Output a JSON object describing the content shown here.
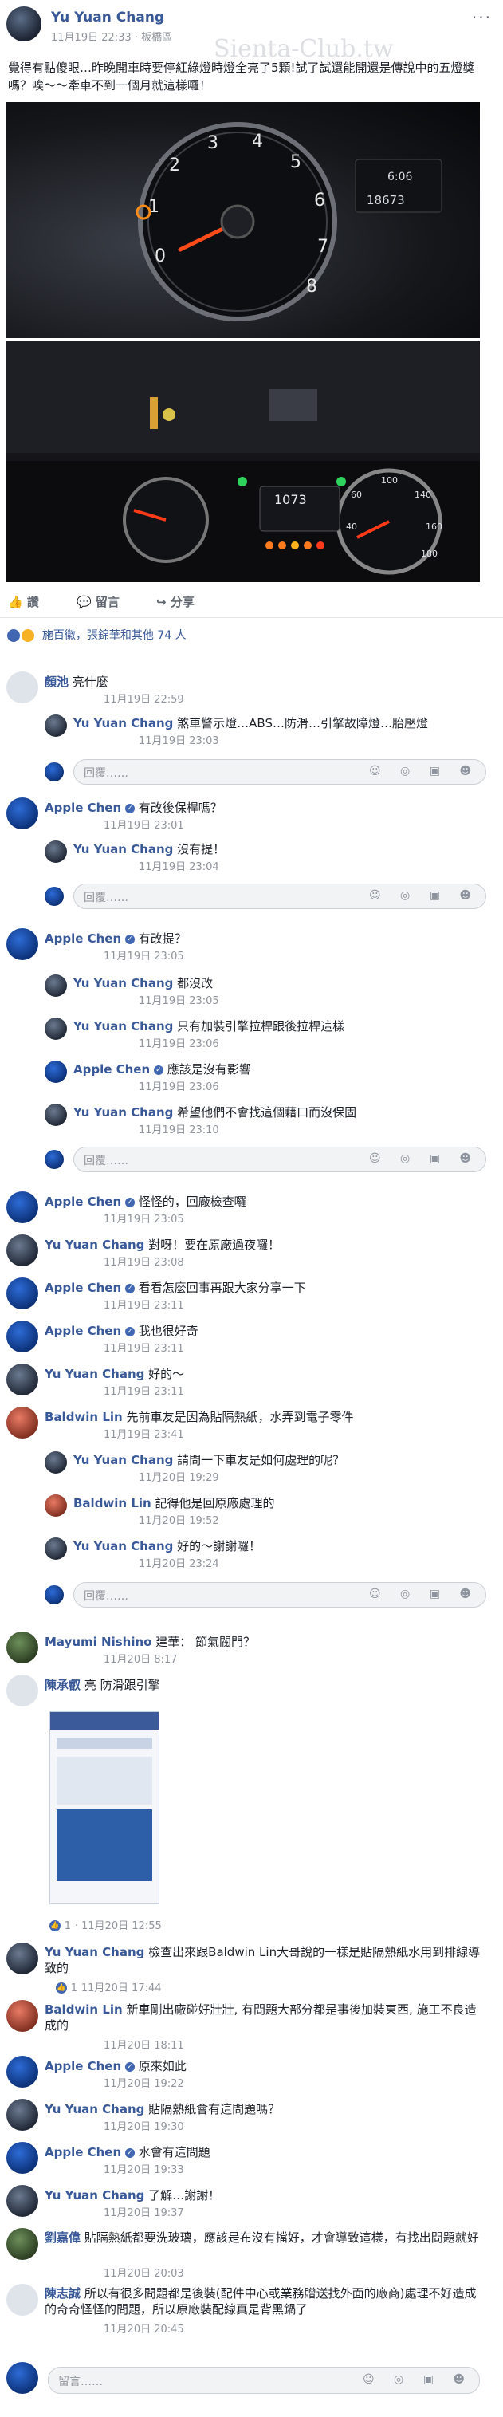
{
  "post": {
    "author": "Yu Yuan Chang",
    "meta": "11月19日 22:33 · 板橋區",
    "watermark": "Sienta-Club.tw",
    "text": "覺得有點傻眼…昨晚開車時要停紅綠燈時燈全亮了5顆!試了試還能開還是傳說中的五燈獎嗎？唉～～牽車不到一個月就這樣囉！",
    "photo1_odometer": "18673",
    "photo2_odometer": "1073",
    "actions": {
      "like": "讚",
      "comment": "留言",
      "share": "分享"
    },
    "reactions_text": "施百徽，張錦華和其他 74 人"
  },
  "comments": [
    {
      "name": "顏池",
      "text": "亮什麼",
      "time": "11月19日 22:59"
    },
    {
      "name": "Yu Yuan Chang",
      "text": "煞車警示燈…ABS…防滑…引擎故障燈…胎壓燈",
      "time": "11月19日 23:03",
      "reply": true
    },
    {
      "name": "Apple Chen",
      "text": "有改後保桿嗎？",
      "time": "11月19日 23:01"
    },
    {
      "name": "Yu Yuan Chang",
      "text": "沒有提！",
      "time": "11月19日 23:04",
      "reply": true
    },
    {
      "name": "Apple Chen",
      "text": "有改提？",
      "time": "11月19日 23:05"
    },
    {
      "name": "Yu Yuan Chang",
      "text": "都沒改",
      "time": "11月19日 23:05",
      "reply": true
    },
    {
      "name": "Yu Yuan Chang",
      "text": "只有加裝引擎拉桿跟後拉桿這樣",
      "time": "11月19日 23:06",
      "reply": true
    },
    {
      "name": "Apple Chen",
      "text": "應該是沒有影響",
      "time": "11月19日 23:06",
      "reply": true
    },
    {
      "name": "Yu Yuan Chang",
      "text": "希望他們不會找這個藉口而沒保固",
      "time": "11月19日 23:10",
      "reply": true
    },
    {
      "name": "Apple Chen",
      "text": "怪怪的，回廠檢查囉",
      "time": "11月19日 23:05"
    },
    {
      "name": "Yu Yuan Chang",
      "text": "對呀！要在原廠過夜囉！",
      "time": "11月19日 23:08"
    },
    {
      "name": "Apple Chen",
      "text": "看看怎麼回事再跟大家分享一下",
      "time": "11月19日 23:11"
    },
    {
      "name": "Apple Chen",
      "text": "我也很好奇",
      "time": "11月19日 23:11"
    },
    {
      "name": "Yu Yuan Chang",
      "text": "好的～",
      "time": "11月19日 23:11"
    },
    {
      "name": "Baldwin Lin",
      "text": "先前車友是因為貼隔熱紙，水弄到電子零件",
      "time": "11月19日 23:41"
    },
    {
      "name": "Yu Yuan Chang",
      "text": "請問一下車友是如何處理的呢？",
      "time": "11月20日 19:29",
      "reply": true
    },
    {
      "name": "Baldwin Lin",
      "text": "記得他是回原廠處理的",
      "time": "11月20日 19:52",
      "reply": true
    },
    {
      "name": "Yu Yuan Chang",
      "text": "好的～謝謝囉！",
      "time": "11月20日 23:24",
      "reply": true
    },
    {
      "name": "Mayumi Nishino",
      "text": "建華： 節氣閥門？",
      "time": "11月20日 8:17"
    },
    {
      "name": "陳承叡",
      "text": "亮 防滑跟引擎",
      "time": "11月20日 12:55"
    },
    {
      "name": "Yu Yuan Chang",
      "text": "檢查出來跟Baldwin Lin大哥說的一樣是貼隔熱紙水用到排線導致的",
      "time": "11月20日 17:44"
    },
    {
      "name": "Baldwin Lin",
      "text": "新車剛出廠碰好壯壯, 有問題大部分都是事後加裝東西, 施工不良造成的",
      "time": "11月20日 18:11"
    },
    {
      "name": "Apple Chen",
      "text": "原來如此",
      "time": "11月20日 19:22"
    },
    {
      "name": "Yu Yuan Chang",
      "text": "貼隔熱紙會有這問題嗎？",
      "time": "11月20日 19:30"
    },
    {
      "name": "Apple Chen",
      "text": "水會有這問題",
      "time": "11月20日 19:33"
    },
    {
      "name": "Yu Yuan Chang",
      "text": "了解…謝謝！",
      "time": "11月20日 19:37"
    },
    {
      "name": "劉嘉偉",
      "text": "貼隔熱紙都要洗玻璃，應該是布沒有擋好，才會導致這樣，有找出問題就好",
      "time": "11月20日 20:03"
    },
    {
      "name": "陳志誠",
      "text": "所以有很多問題都是後裝(配件中心或業務贈送找外面的廠商)處理不好造成的奇奇怪怪的問題，所以原廠裝配線真是背黑鍋了",
      "time": "11月20日 20:45"
    }
  ],
  "ui": {
    "reply_placeholder": "回覆……",
    "comment_placeholder": "留言……",
    "likes_count": "1",
    "photo_caption": "陳承叡亮 防滑跟引擎"
  }
}
